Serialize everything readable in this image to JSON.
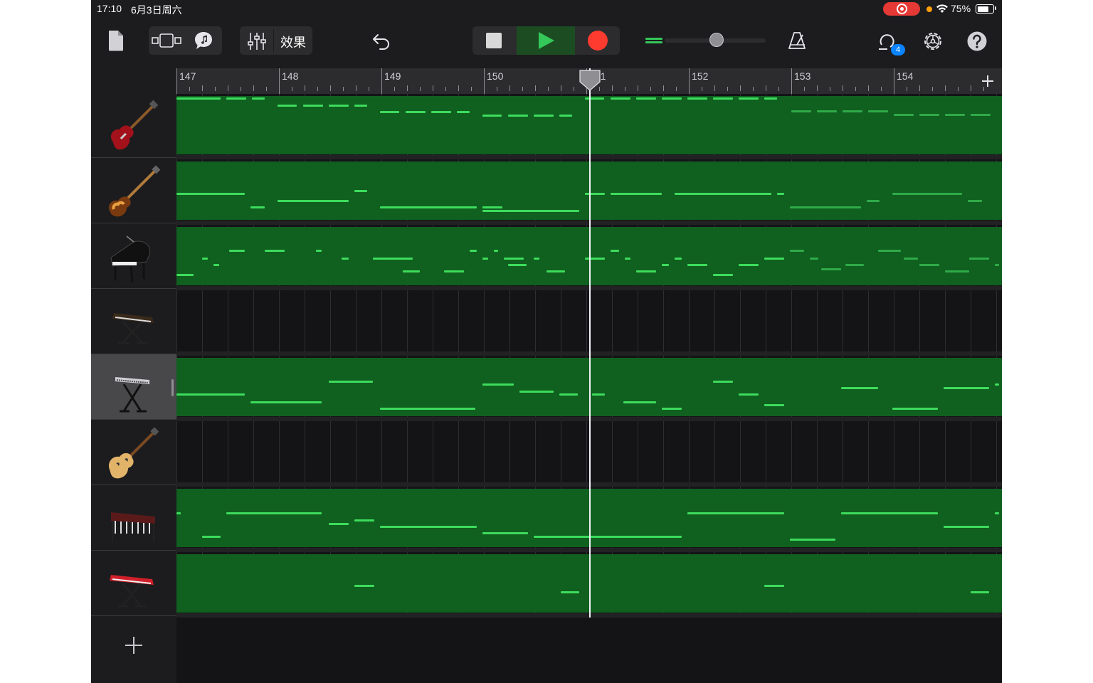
{
  "status_bar": {
    "time": "17:10",
    "date": "6月3日周六",
    "battery_percent": "75%",
    "battery_level": 0.75,
    "recording_indicator": "screen-record-icon"
  },
  "toolbar": {
    "fx_label": "效果",
    "loop_count": "4",
    "volume_level": 0.62,
    "icons": [
      "document-icon",
      "track-view-icon",
      "loop-browser-icon",
      "mixer-icon",
      "undo-icon",
      "stop-icon",
      "play-icon",
      "record-icon",
      "metronome-icon",
      "loop-icon",
      "settings-icon",
      "help-icon"
    ]
  },
  "ruler": {
    "bars": [
      "147",
      "148",
      "149",
      "150",
      "151",
      "152",
      "153",
      "154"
    ]
  },
  "playhead_bar": 151,
  "tracks": [
    {
      "name": "electric-guitar",
      "instrument_icon": "electric-guitar-icon",
      "has_region": true,
      "selected": false
    },
    {
      "name": "bass",
      "instrument_icon": "bass-guitar-icon",
      "has_region": true,
      "selected": false
    },
    {
      "name": "grand-piano",
      "instrument_icon": "grand-piano-icon",
      "has_region": true,
      "selected": false
    },
    {
      "name": "vintage-keyboard",
      "instrument_icon": "stage-keyboard-icon",
      "has_region": false,
      "selected": false
    },
    {
      "name": "synth-keyboard",
      "instrument_icon": "synth-keyboard-icon",
      "has_region": true,
      "selected": true
    },
    {
      "name": "hollow-body-guitar",
      "instrument_icon": "hollow-guitar-icon",
      "has_region": false,
      "selected": false
    },
    {
      "name": "vibraphone",
      "instrument_icon": "vibraphone-icon",
      "has_region": true,
      "selected": false
    },
    {
      "name": "red-organ",
      "instrument_icon": "red-organ-icon",
      "has_region": true,
      "selected": false
    }
  ],
  "colors": {
    "region_green": "#106020",
    "note_green": "#3ddc5c",
    "record_red": "#ff3b30",
    "play_green": "#34c759",
    "badge_blue": "#0a84ff"
  }
}
